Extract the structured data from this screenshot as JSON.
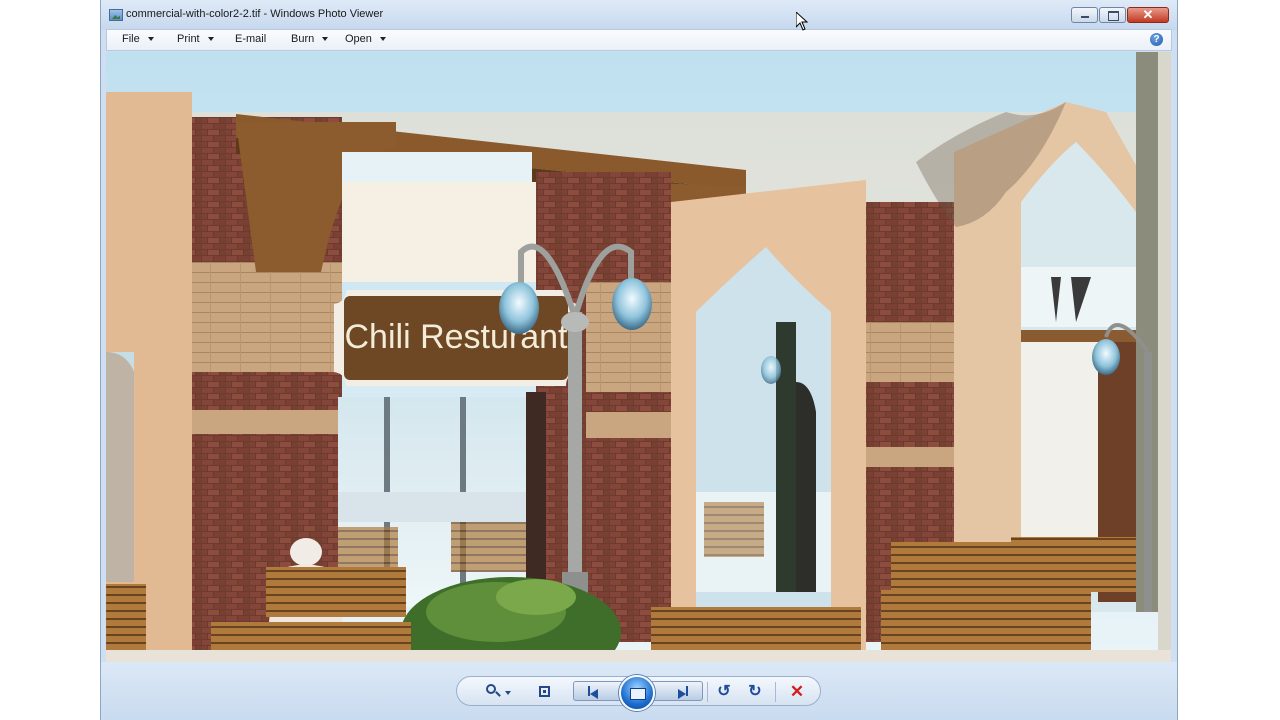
{
  "window": {
    "title": "commercial-with-color2-2.tif - Windows Photo Viewer",
    "close_glyph": "✕"
  },
  "menu": {
    "items": [
      "File",
      "Print",
      "E-mail",
      "Burn",
      "Open"
    ],
    "help_glyph": "?"
  },
  "image": {
    "sign_text": "Chili Resturant"
  },
  "toolbar": {
    "rotate_ccw_glyph": "↺",
    "rotate_cw_glyph": "↻",
    "delete_glyph": "✕"
  },
  "colors": {
    "frame": "#cfdff1",
    "accent": "#1f4d9e",
    "close": "#c23a22",
    "delete": "#d21e1e"
  },
  "icons": [
    "app-icon",
    "minimize-icon",
    "maximize-icon",
    "close-icon",
    "help-icon",
    "zoom-icon",
    "actual-size-icon",
    "previous-icon",
    "slideshow-icon",
    "next-icon",
    "rotate-counterclockwise-icon",
    "rotate-clockwise-icon",
    "delete-icon",
    "mouse-cursor-icon"
  ]
}
